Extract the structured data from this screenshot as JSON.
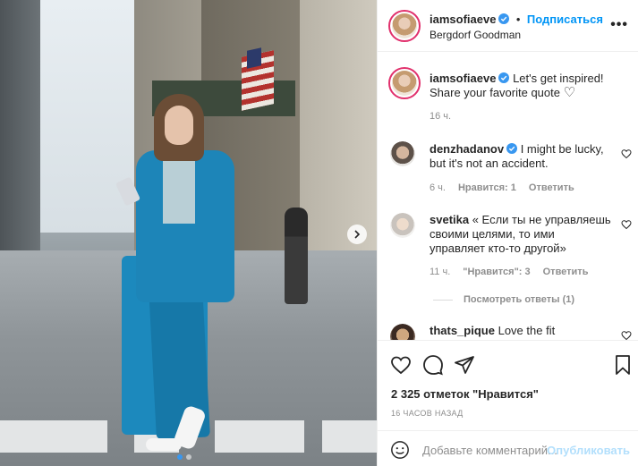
{
  "post": {
    "author": "iamsofiaeve",
    "follow_label": "Подписаться",
    "follow_dot": "•",
    "location": "Bergdorf Goodman",
    "more_label": "•••"
  },
  "caption": {
    "author": "iamsofiaeve",
    "text": "Let's get inspired! Share your favorite quote",
    "heart": "♡",
    "time": "16 ч."
  },
  "comments": [
    {
      "author": "denzhadanov",
      "verified": true,
      "text": "I might be lucky, but it's not an accident.",
      "time": "6 ч.",
      "likes": "Нравится: 1",
      "reply": "Ответить"
    },
    {
      "author": "svetika",
      "verified": false,
      "text": "« Если ты не управляешь своими целями, то ими управляет кто-то другой»",
      "time": "11 ч.",
      "likes": "\"Нравится\": 3",
      "reply": "Ответить",
      "view_replies": "Посмотреть ответы (1)"
    },
    {
      "author": "thats_pique",
      "verified": false,
      "text": "Love the fit"
    }
  ],
  "footer": {
    "likes": "2 325 отметок \"Нравится\"",
    "time": "16 ЧАСОВ НАЗАД",
    "comment_placeholder": "Добавьте комментарий...",
    "publish_label": "Опубликовать"
  },
  "colors": {
    "accent": "#0095f6",
    "verified": "#3897f0",
    "muted": "#8e8e8e"
  },
  "icons": [
    "next-arrow-icon",
    "more-icon",
    "verified-icon",
    "heart-icon",
    "comment-icon",
    "share-icon",
    "bookmark-icon",
    "emoji-icon"
  ],
  "carousel": {
    "slides": 2,
    "active": 1
  }
}
